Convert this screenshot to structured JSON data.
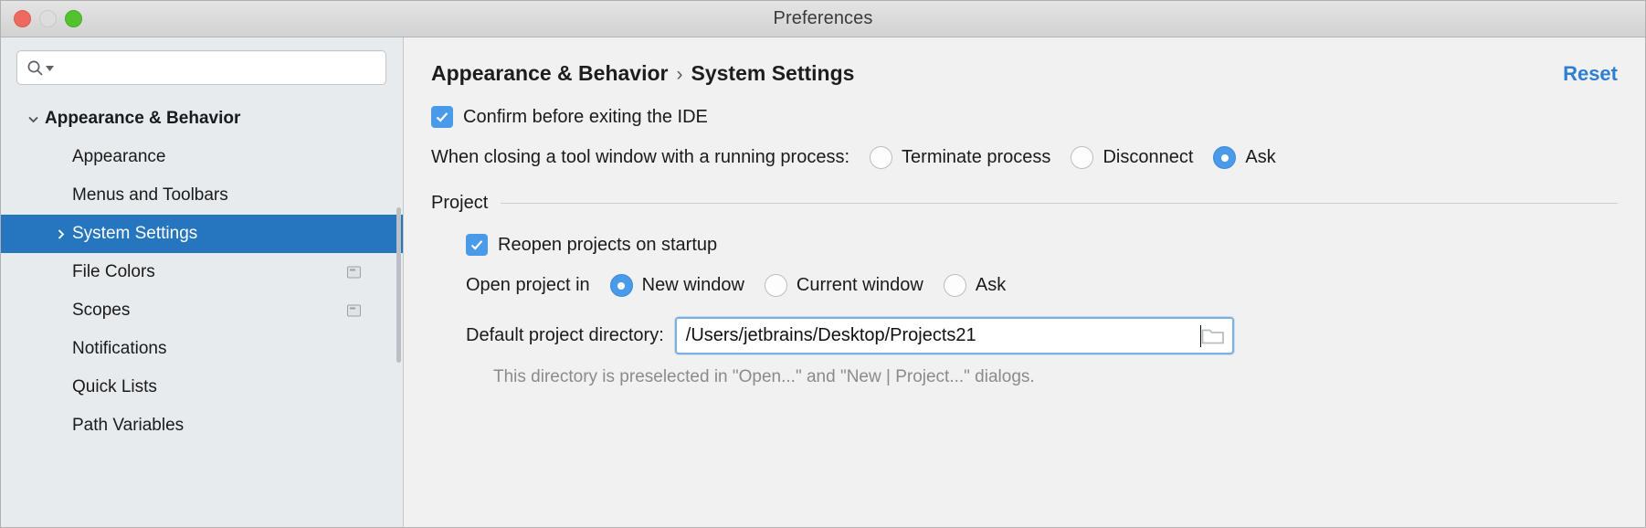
{
  "window": {
    "title": "Preferences",
    "traffic_lights": [
      "close-button",
      "minimize-button",
      "maximize-button"
    ]
  },
  "sidebar": {
    "search": {
      "value": "",
      "placeholder": ""
    },
    "items": [
      {
        "label": "Appearance & Behavior",
        "level": 0,
        "expanded": true,
        "selected": false,
        "badge": false
      },
      {
        "label": "Appearance",
        "level": 1,
        "selected": false,
        "badge": false
      },
      {
        "label": "Menus and Toolbars",
        "level": 1,
        "selected": false,
        "badge": false
      },
      {
        "label": "System Settings",
        "level": 1,
        "selected": true,
        "badge": false
      },
      {
        "label": "File Colors",
        "level": 1,
        "selected": false,
        "badge": true
      },
      {
        "label": "Scopes",
        "level": 1,
        "selected": false,
        "badge": true
      },
      {
        "label": "Notifications",
        "level": 1,
        "selected": false,
        "badge": false
      },
      {
        "label": "Quick Lists",
        "level": 1,
        "selected": false,
        "badge": false
      },
      {
        "label": "Path Variables",
        "level": 1,
        "selected": false,
        "badge": false
      }
    ]
  },
  "main": {
    "breadcrumb": {
      "parent": "Appearance & Behavior",
      "separator": "›",
      "current": "System Settings"
    },
    "reset_label": "Reset",
    "confirm_exit": {
      "label": "Confirm before exiting the IDE",
      "checked": true
    },
    "tool_window": {
      "label": "When closing a tool window with a running process:",
      "options": [
        {
          "label": "Terminate process",
          "selected": false
        },
        {
          "label": "Disconnect",
          "selected": false
        },
        {
          "label": "Ask",
          "selected": true
        }
      ]
    },
    "project_group": {
      "title": "Project",
      "reopen": {
        "label": "Reopen projects on startup",
        "checked": true
      },
      "open_project_in": {
        "label": "Open project in",
        "options": [
          {
            "label": "New window",
            "selected": true
          },
          {
            "label": "Current window",
            "selected": false
          },
          {
            "label": "Ask",
            "selected": false
          }
        ]
      },
      "default_directory": {
        "label": "Default project directory:",
        "value": "/Users/jetbrains/Desktop/Projects21",
        "placeholder": "",
        "browse_icon": "folder-icon",
        "hint": "This directory is preselected in \"Open...\" and \"New | Project...\" dialogs."
      }
    }
  },
  "colors": {
    "accent_blue": "#2675bf",
    "link_blue": "#2f7fd1",
    "control_blue": "#4a9aea",
    "sidebar_bg": "#e7ebee",
    "main_bg": "#f1f1f1"
  }
}
